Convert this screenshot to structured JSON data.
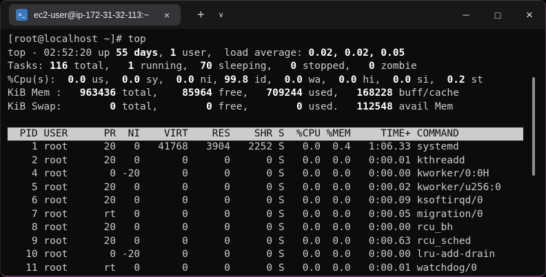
{
  "colors": {
    "terminal_bg": "#0c0c0c",
    "titlebar_bg": "#181818",
    "tab_bg": "#323438",
    "text": "#cccccc",
    "bold_text": "#ffffff",
    "header_bg": "#cccccc",
    "header_text": "#0c0c0c",
    "icon_blue": "#3b78bf",
    "accent_border": "#5e2f56",
    "scrollbar": "#8f8f8f"
  },
  "titlebar": {
    "tab_title": "ec2-user@ip-172-31-32-113:~",
    "tab_icon_glyph": ">_",
    "tab_close_glyph": "×",
    "new_tab_glyph": "+",
    "dropdown_glyph": "∨",
    "minimize_glyph": "─",
    "maximize_glyph": "□",
    "close_glyph": "×"
  },
  "terminal": {
    "prompt_line": "[root@localhost ~]# top",
    "summary_lines": [
      [
        {
          "t": "top - 02:52:20 up ",
          "b": false
        },
        {
          "t": "55 days",
          "b": true
        },
        {
          "t": ", ",
          "b": false
        },
        {
          "t": "1",
          "b": true
        },
        {
          "t": " user,  load average: ",
          "b": false
        },
        {
          "t": "0.02, 0.02, 0.05",
          "b": true
        }
      ],
      [
        {
          "t": "Tasks: ",
          "b": false
        },
        {
          "t": "116",
          "b": true
        },
        {
          "t": " total,   ",
          "b": false
        },
        {
          "t": "1",
          "b": true
        },
        {
          "t": " running,  ",
          "b": false
        },
        {
          "t": "70",
          "b": true
        },
        {
          "t": " sleeping,   ",
          "b": false
        },
        {
          "t": "0",
          "b": true
        },
        {
          "t": " stopped,   ",
          "b": false
        },
        {
          "t": "0",
          "b": true
        },
        {
          "t": " zombie",
          "b": false
        }
      ],
      [
        {
          "t": "%Cpu(s):  ",
          "b": false
        },
        {
          "t": "0.0",
          "b": true
        },
        {
          "t": " us,  ",
          "b": false
        },
        {
          "t": "0.0",
          "b": true
        },
        {
          "t": " sy,  ",
          "b": false
        },
        {
          "t": "0.0",
          "b": true
        },
        {
          "t": " ni, ",
          "b": false
        },
        {
          "t": "99.8",
          "b": true
        },
        {
          "t": " id,  ",
          "b": false
        },
        {
          "t": "0.0",
          "b": true
        },
        {
          "t": " wa,  ",
          "b": false
        },
        {
          "t": "0.0",
          "b": true
        },
        {
          "t": " hi,  ",
          "b": false
        },
        {
          "t": "0.0",
          "b": true
        },
        {
          "t": " si,  ",
          "b": false
        },
        {
          "t": "0.2",
          "b": true
        },
        {
          "t": " st",
          "b": false
        }
      ],
      [
        {
          "t": "KiB Mem :   ",
          "b": false
        },
        {
          "t": "963436",
          "b": true
        },
        {
          "t": " total,    ",
          "b": false
        },
        {
          "t": "85964",
          "b": true
        },
        {
          "t": " free,   ",
          "b": false
        },
        {
          "t": "709244",
          "b": true
        },
        {
          "t": " used,   ",
          "b": false
        },
        {
          "t": "168228",
          "b": true
        },
        {
          "t": " buff/cache",
          "b": false
        }
      ],
      [
        {
          "t": "KiB Swap:        ",
          "b": false
        },
        {
          "t": "0",
          "b": true
        },
        {
          "t": " total,        ",
          "b": false
        },
        {
          "t": "0",
          "b": true
        },
        {
          "t": " free,        ",
          "b": false
        },
        {
          "t": "0",
          "b": true
        },
        {
          "t": " used.   ",
          "b": false
        },
        {
          "t": "112548",
          "b": true
        },
        {
          "t": " avail Mem",
          "b": false
        }
      ]
    ],
    "table": {
      "columns": [
        {
          "label": "PID",
          "width": 5,
          "align": "right"
        },
        {
          "label": "USER",
          "width": 8,
          "align": "left"
        },
        {
          "label": "PR",
          "width": 3,
          "align": "right"
        },
        {
          "label": "NI",
          "width": 3,
          "align": "right"
        },
        {
          "label": "VIRT",
          "width": 7,
          "align": "right"
        },
        {
          "label": "RES",
          "width": 6,
          "align": "right"
        },
        {
          "label": "SHR",
          "width": 6,
          "align": "right"
        },
        {
          "label": "S",
          "width": 1,
          "align": "left"
        },
        {
          "label": "%CPU",
          "width": 5,
          "align": "right"
        },
        {
          "label": "%MEM",
          "width": 4,
          "align": "right"
        },
        {
          "label": "TIME+",
          "width": 9,
          "align": "right"
        },
        {
          "label": "COMMAND",
          "width": 0,
          "align": "left"
        }
      ],
      "rows": [
        [
          "1",
          "root",
          "20",
          "0",
          "41768",
          "3904",
          "2252",
          "S",
          "0.0",
          "0.4",
          "1:06.33",
          "systemd"
        ],
        [
          "2",
          "root",
          "20",
          "0",
          "0",
          "0",
          "0",
          "S",
          "0.0",
          "0.0",
          "0:00.01",
          "kthreadd"
        ],
        [
          "4",
          "root",
          "0",
          "-20",
          "0",
          "0",
          "0",
          "S",
          "0.0",
          "0.0",
          "0:00.00",
          "kworker/0:0H"
        ],
        [
          "5",
          "root",
          "20",
          "0",
          "0",
          "0",
          "0",
          "S",
          "0.0",
          "0.0",
          "0:00.02",
          "kworker/u256:0"
        ],
        [
          "6",
          "root",
          "20",
          "0",
          "0",
          "0",
          "0",
          "S",
          "0.0",
          "0.0",
          "0:00.09",
          "ksoftirqd/0"
        ],
        [
          "7",
          "root",
          "rt",
          "0",
          "0",
          "0",
          "0",
          "S",
          "0.0",
          "0.0",
          "0:00.05",
          "migration/0"
        ],
        [
          "8",
          "root",
          "20",
          "0",
          "0",
          "0",
          "0",
          "S",
          "0.0",
          "0.0",
          "0:00.00",
          "rcu_bh"
        ],
        [
          "9",
          "root",
          "20",
          "0",
          "0",
          "0",
          "0",
          "S",
          "0.0",
          "0.0",
          "0:00.63",
          "rcu_sched"
        ],
        [
          "10",
          "root",
          "0",
          "-20",
          "0",
          "0",
          "0",
          "S",
          "0.0",
          "0.0",
          "0:00.00",
          "lru-add-drain"
        ],
        [
          "11",
          "root",
          "rt",
          "0",
          "0",
          "0",
          "0",
          "S",
          "0.0",
          "0.0",
          "0:00.01",
          "watchdog/0"
        ]
      ]
    }
  }
}
